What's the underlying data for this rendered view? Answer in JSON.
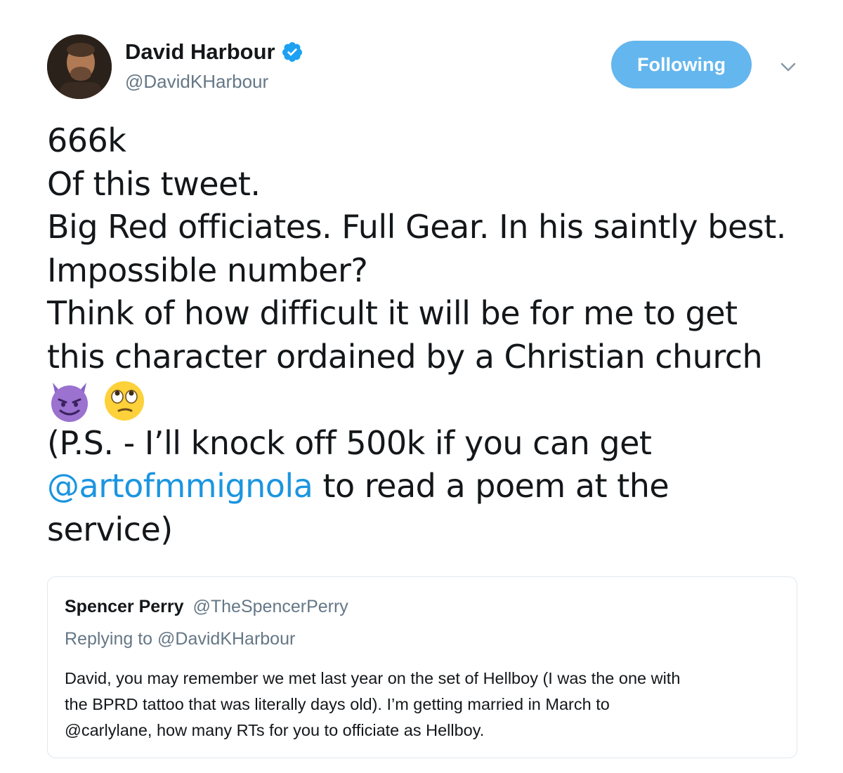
{
  "author": {
    "name": "David Harbour",
    "handle": "@DavidKHarbour",
    "verified_icon": "verified-badge-icon"
  },
  "actions": {
    "follow_label": "Following",
    "menu_icon": "chevron-down-icon"
  },
  "tweet": {
    "lines": [
      "666k",
      "Of this tweet.",
      "Big Red officiates. Full Gear. In his saintly best.",
      "Impossible number?",
      "Think of how difficult it will be for me to get",
      "this character ordained by a Christian church"
    ],
    "emojis": [
      "smiling-devil-emoji",
      "rolling-eyes-emoji"
    ],
    "ps_line": "(P.S. - I’ll knock off 500k if you can get",
    "mention": "@artofmmignola",
    "after_mention": " to read a poem at the",
    "final_line": "service)"
  },
  "quoted_tweet": {
    "name": "Spencer Perry",
    "handle": "@TheSpencerPerry",
    "replying_to": "Replying to @DavidKHarbour",
    "text_lines": [
      "David, you may remember we met last year on the set of Hellboy (I was the one with",
      "the BPRD tattoo that was literally days old). I’m getting married in March to",
      "@carlylane, how many RTs for you to officiate as Hellboy."
    ]
  },
  "colors": {
    "follow_button": "#64b6ee",
    "mention": "#1b95e0",
    "secondary_text": "#657786",
    "border": "#e1e8ed"
  }
}
